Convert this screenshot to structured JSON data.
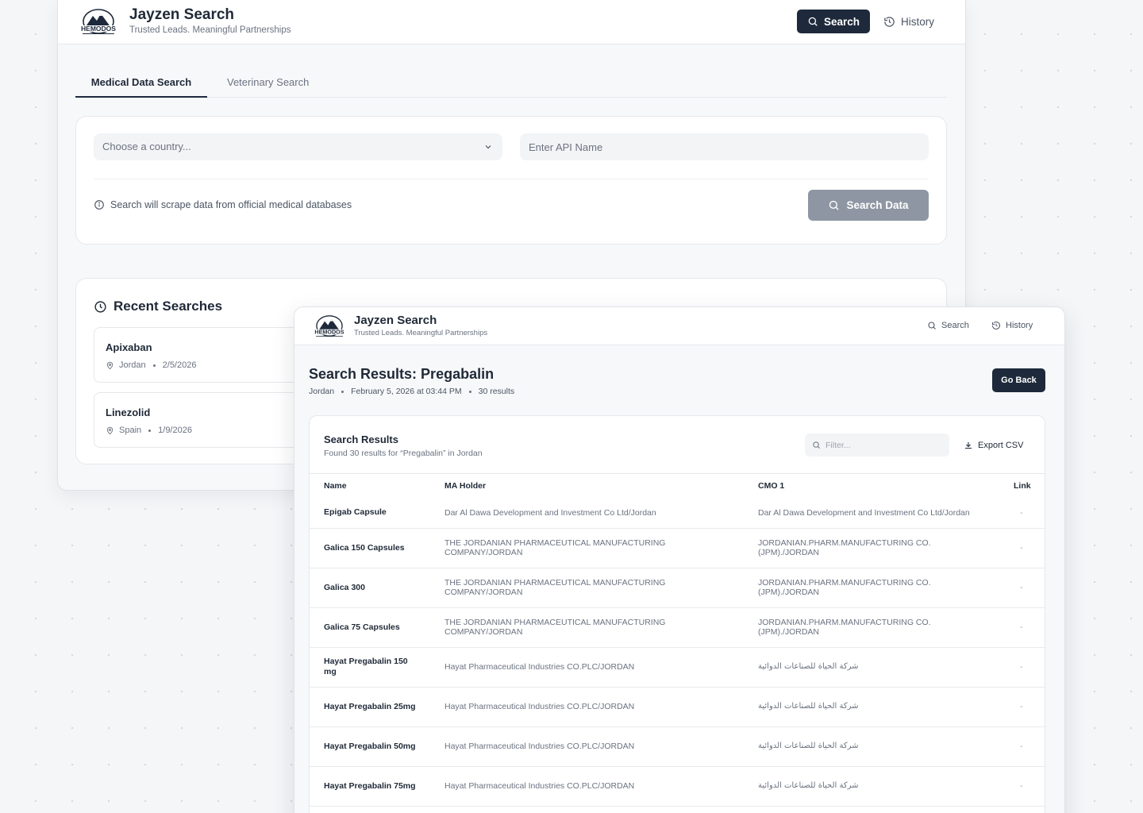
{
  "app": {
    "title": "Jayzen Search",
    "tagline": "Trusted Leads. Meaningful Partnerships",
    "logo_text": "HEMODOS"
  },
  "colors": {
    "primary": "#1e2a3b",
    "disabled_button": "#8e96a3",
    "muted_text": "#6b7280",
    "background": "#f5f6f8"
  },
  "window1": {
    "nav": {
      "search_label": "Search",
      "history_label": "History"
    },
    "tabs": [
      {
        "label": "Medical Data Search",
        "active": true
      },
      {
        "label": "Veterinary Search",
        "active": false
      }
    ],
    "search_form": {
      "country_placeholder": "Choose a country...",
      "api_placeholder": "Enter API Name",
      "info_text": "Search will scrape data from official medical databases",
      "submit_label": "Search Data"
    },
    "recent": {
      "title": "Recent Searches",
      "items": [
        {
          "name": "Apixaban",
          "country": "Jordan",
          "date": "2/5/2026"
        },
        {
          "name": "Linezolid",
          "country": "Spain",
          "date": "1/9/2026"
        }
      ]
    }
  },
  "window2": {
    "nav": {
      "search_label": "Search",
      "history_label": "History"
    },
    "results_title": "Search Results: Pregabalin",
    "meta": {
      "country": "Jordan",
      "datetime": "February 5, 2026 at 03:44 PM",
      "count": "30 results"
    },
    "go_back_label": "Go Back",
    "table_card": {
      "title": "Search Results",
      "subtitle": "Found 30 results for “Pregabalin” in Jordan",
      "filter_placeholder": "Filter...",
      "export_label": "Export CSV",
      "columns": [
        "Name",
        "MA Holder",
        "CMO 1",
        "Link"
      ],
      "rows": [
        {
          "name": "Epigab Capsule",
          "ma_holder": "Dar Al Dawa Development and Investment Co Ltd/Jordan",
          "cmo": "Dar Al Dawa Development and Investment Co Ltd/Jordan",
          "link": "-"
        },
        {
          "name": "Galica 150 Capsules",
          "ma_holder": "THE JORDANIAN PHARMACEUTICAL MANUFACTURING COMPANY/JORDAN",
          "cmo": "JORDANIAN.PHARM.MANUFACTURING CO.(JPM)./JORDAN",
          "link": "-"
        },
        {
          "name": "Galica 300",
          "ma_holder": "THE JORDANIAN PHARMACEUTICAL MANUFACTURING COMPANY/JORDAN",
          "cmo": "JORDANIAN.PHARM.MANUFACTURING CO.(JPM)./JORDAN",
          "link": "-"
        },
        {
          "name": "Galica 75 Capsules",
          "ma_holder": "THE JORDANIAN PHARMACEUTICAL MANUFACTURING COMPANY/JORDAN",
          "cmo": "JORDANIAN.PHARM.MANUFACTURING CO.(JPM)./JORDAN",
          "link": "-"
        },
        {
          "name": "Hayat Pregabalin 150 mg",
          "ma_holder": "Hayat Pharmaceutical Industries CO.PLC/JORDAN",
          "cmo": "شركة الحياة للصناعات الدوائية",
          "link": "-"
        },
        {
          "name": "Hayat Pregabalin 25mg",
          "ma_holder": "Hayat Pharmaceutical Industries CO.PLC/JORDAN",
          "cmo": "شركة الحياة للصناعات الدوائية",
          "link": "-"
        },
        {
          "name": "Hayat Pregabalin 50mg",
          "ma_holder": "Hayat Pharmaceutical Industries CO.PLC/JORDAN",
          "cmo": "شركة الحياة للصناعات الدوائية",
          "link": "-"
        },
        {
          "name": "Hayat Pregabalin 75mg",
          "ma_holder": "Hayat Pharmaceutical Industries CO.PLC/JORDAN",
          "cmo": "شركة الحياة للصناعات الدوائية",
          "link": "-"
        }
      ]
    }
  }
}
